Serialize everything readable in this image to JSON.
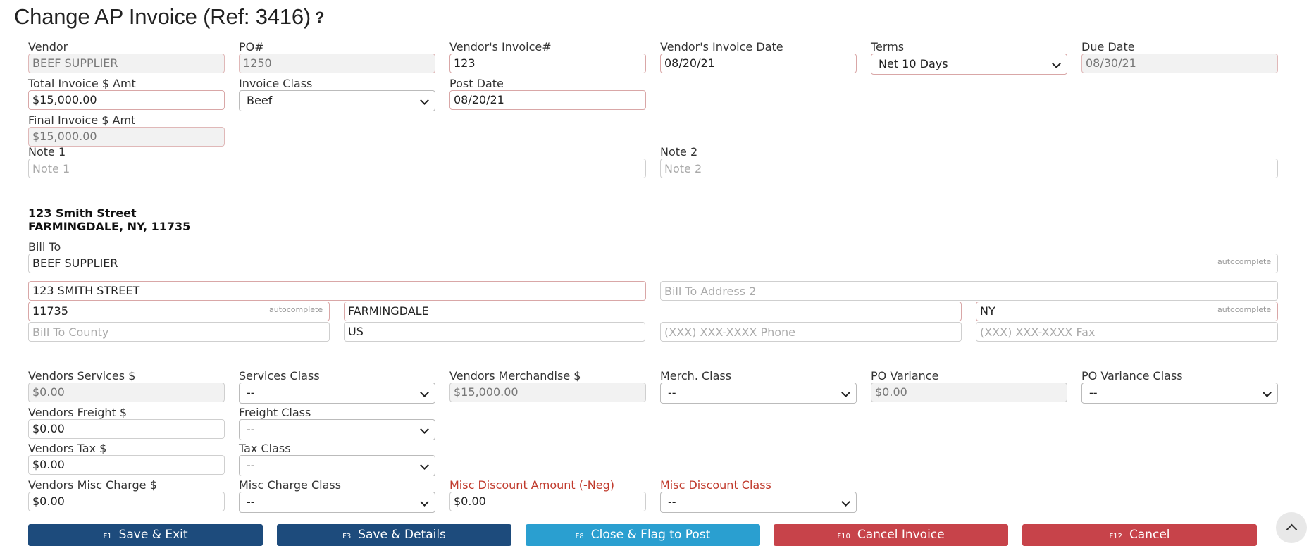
{
  "page": {
    "title": "Change AP Invoice (Ref: 3416)",
    "help_icon": "?"
  },
  "header_fields": {
    "vendor": {
      "label": "Vendor",
      "value": "BEEF SUPPLIER"
    },
    "po": {
      "label": "PO#",
      "value": "1250"
    },
    "vendor_invoice": {
      "label": "Vendor's Invoice#",
      "value": "123"
    },
    "vendor_invoice_date": {
      "label": "Vendor's Invoice Date",
      "value": "08/20/21"
    },
    "terms": {
      "label": "Terms",
      "value": "Net 10 Days"
    },
    "due_date": {
      "label": "Due Date",
      "value": "08/30/21"
    },
    "total_invoice": {
      "label": "Total Invoice $ Amt",
      "value": "$15,000.00"
    },
    "invoice_class": {
      "label": "Invoice Class",
      "value": "Beef"
    },
    "post_date": {
      "label": "Post Date",
      "value": "08/20/21"
    },
    "final_invoice": {
      "label": "Final Invoice $ Amt",
      "value": "$15,000.00"
    },
    "note1": {
      "label": "Note 1",
      "placeholder": "Note 1",
      "value": ""
    },
    "note2": {
      "label": "Note 2",
      "placeholder": "Note 2",
      "value": ""
    }
  },
  "address": {
    "line1": "123 Smith Street",
    "line2": "FARMINGDALE, NY, 11735"
  },
  "bill_to": {
    "label": "Bill To",
    "name": "BEEF SUPPLIER",
    "address1": "123 SMITH STREET",
    "address2_placeholder": "Bill To Address 2",
    "zip": "11735",
    "city": "FARMINGDALE",
    "state": "NY",
    "county_placeholder": "Bill To County",
    "country": "US",
    "phone_placeholder": "(XXX) XXX-XXXX Phone",
    "fax_placeholder": "(XXX) XXX-XXXX Fax",
    "autocomplete_hint": "autocomplete"
  },
  "charges": {
    "vendors_services": {
      "label": "Vendors Services $",
      "value": "$0.00"
    },
    "services_class": {
      "label": "Services Class",
      "value": "--"
    },
    "vendors_merchandise": {
      "label": "Vendors Merchandise $",
      "value": "$15,000.00"
    },
    "merch_class": {
      "label": "Merch. Class",
      "value": "--"
    },
    "po_variance": {
      "label": "PO Variance",
      "value": "$0.00"
    },
    "po_variance_class": {
      "label": "PO Variance Class",
      "value": "--"
    },
    "vendors_freight": {
      "label": "Vendors Freight $",
      "value": "$0.00"
    },
    "freight_class": {
      "label": "Freight Class",
      "value": "--"
    },
    "vendors_tax": {
      "label": "Vendors Tax $",
      "value": "$0.00"
    },
    "tax_class": {
      "label": "Tax Class",
      "value": "--"
    },
    "vendors_misc": {
      "label": "Vendors Misc Charge $",
      "value": "$0.00"
    },
    "misc_class": {
      "label": "Misc Charge Class",
      "value": "--"
    },
    "misc_discount": {
      "label": "Misc Discount Amount (-Neg)",
      "value": "$0.00"
    },
    "misc_discount_class": {
      "label": "Misc Discount Class",
      "value": "--"
    }
  },
  "buttons": {
    "save_exit": {
      "key": "F1",
      "label": "Save & Exit"
    },
    "save_details": {
      "key": "F3",
      "label": "Save & Details"
    },
    "close_flag": {
      "key": "F8",
      "label": "Close & Flag to Post"
    },
    "cancel_invoice": {
      "key": "F10",
      "label": "Cancel Invoice"
    },
    "cancel": {
      "key": "F12",
      "label": "Cancel"
    }
  },
  "colors": {
    "navy": "#1d4b7c",
    "blue": "#2a9fd0",
    "red": "#c7434a",
    "label_red": "#c0392b"
  }
}
